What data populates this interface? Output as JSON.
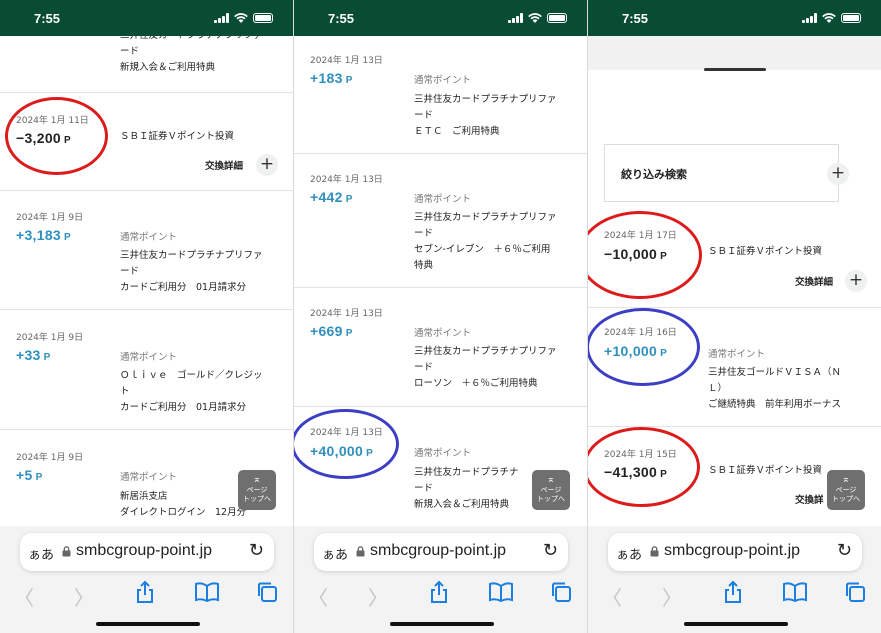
{
  "status": {
    "time": "7:55"
  },
  "browser": {
    "aa": "ぁあ",
    "domain": "smbcgroup-point.jp"
  },
  "top_button": {
    "arrow": "⌅",
    "label": "ページ\nトップへ"
  },
  "screen1": {
    "partial_top": {
      "desc": "三井住友カードプラチナプリファ\nード\n新規入会＆ご利用特典"
    },
    "entries": [
      {
        "date": "2024年 1月 11日",
        "amount": "−3,200",
        "unit": "P",
        "type": "",
        "desc": "ＳＢＩ証券Ｖポイント投資",
        "detail": "交換詳細"
      },
      {
        "date": "2024年 1月 9日",
        "amount": "+3,183",
        "unit": "P",
        "type": "通常ポイント",
        "desc": "三井住友カードプラチナプリファ\nード\nカードご利用分　01月請求分"
      },
      {
        "date": "2024年 1月 9日",
        "amount": "+33",
        "unit": "P",
        "type": "通常ポイント",
        "desc": "Ｏｌｉｖｅ　ゴールド／クレジッ\nト\nカードご利用分　01月請求分"
      },
      {
        "date": "2024年 1月 9日",
        "amount": "+5",
        "unit": "P",
        "type": "通常ポイント",
        "desc": "新居浜支店\nダイレクトログイン　12月分"
      }
    ]
  },
  "screen2": {
    "entries": [
      {
        "date": "2024年 1月 13日",
        "amount": "+183",
        "unit": "P",
        "type": "通常ポイント",
        "desc": "三井住友カードプラチナプリファ\nード\nＥＴＣ　ご利用特典"
      },
      {
        "date": "2024年 1月 13日",
        "amount": "+442",
        "unit": "P",
        "type": "通常ポイント",
        "desc": "三井住友カードプラチナプリファ\nード\nセブン-イレブン　＋６％ご利用\n特典"
      },
      {
        "date": "2024年 1月 13日",
        "amount": "+669",
        "unit": "P",
        "type": "通常ポイント",
        "desc": "三井住友カードプラチナプリファ\nード\nローソン　＋６％ご利用特典"
      },
      {
        "date": "2024年 1月 13日",
        "amount": "+40,000",
        "unit": "P",
        "type": "通常ポイント",
        "desc": "三井住友カードプラチナ\nード\n新規入会＆ご利用特典"
      }
    ]
  },
  "screen3": {
    "filter_label": "絞り込み検索",
    "entries": [
      {
        "date": "2024年 1月 17日",
        "amount": "−10,000",
        "unit": "P",
        "type": "",
        "desc": "ＳＢＩ証券Ｖポイント投資",
        "detail": "交換詳細"
      },
      {
        "date": "2024年 1月 16日",
        "amount": "+10,000",
        "unit": "P",
        "type": "通常ポイント",
        "desc": "三井住友ゴールドＶＩＳＡ（Ｎ\nＬ）\nご継続特典　前年利用ボーナス"
      },
      {
        "date": "2024年 1月 15日",
        "amount": "−41,300",
        "unit": "P",
        "type": "",
        "desc": "ＳＢＩ証券Ｖポイント投資",
        "detail": "交換詳"
      }
    ]
  },
  "colors": {
    "header_green": "#074c33",
    "plus_blue": "#2f8fbd",
    "ring_red": "#de1b1b",
    "ring_blue": "#3c3fc4"
  }
}
